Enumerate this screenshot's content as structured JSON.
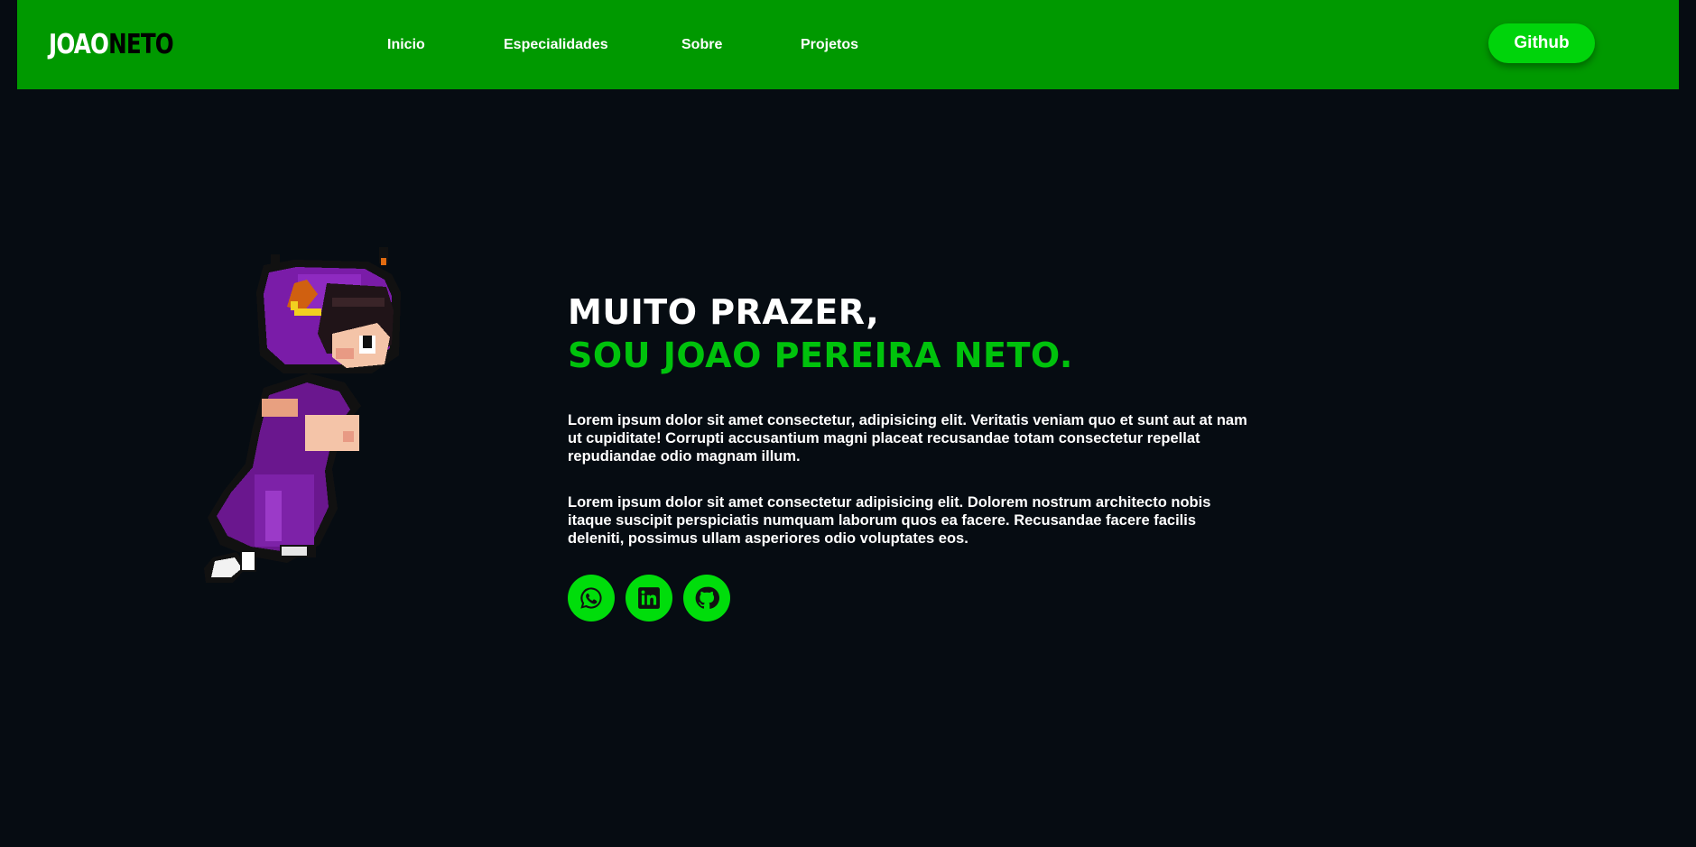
{
  "nav": {
    "logo_first": "JOAO",
    "logo_last": "NETO",
    "links": [
      "Inicio",
      "Especialidades",
      "Sobre",
      "Projetos"
    ],
    "github_label": "Github"
  },
  "hero": {
    "headline_1": "MUITO PRAZER,",
    "headline_2": "SOU JOAO PEREIRA NETO.",
    "paragraph_1": "Lorem ipsum dolor sit amet consectetur, adipisicing elit. Veritatis veniam quo et sunt aut at nam ut cupiditate! Corrupti accusantium magni placeat recusandae totam consectetur repellat repudiandae odio magnam illum.",
    "paragraph_2": "Lorem ipsum dolor sit amet consectetur adipisicing elit. Dolorem nostrum architecto nobis itaque suscipit perspiciatis numquam laborum quos ea facere. Recusandae facere facilis deleniti, possimus ullam asperiores odio voluptates eos.",
    "socials": [
      "whatsapp-icon",
      "linkedin-icon",
      "github-icon"
    ]
  },
  "colors": {
    "navbar": "#009900",
    "accent": "#00c20c",
    "button": "#00d40b",
    "background": "#060c12"
  }
}
